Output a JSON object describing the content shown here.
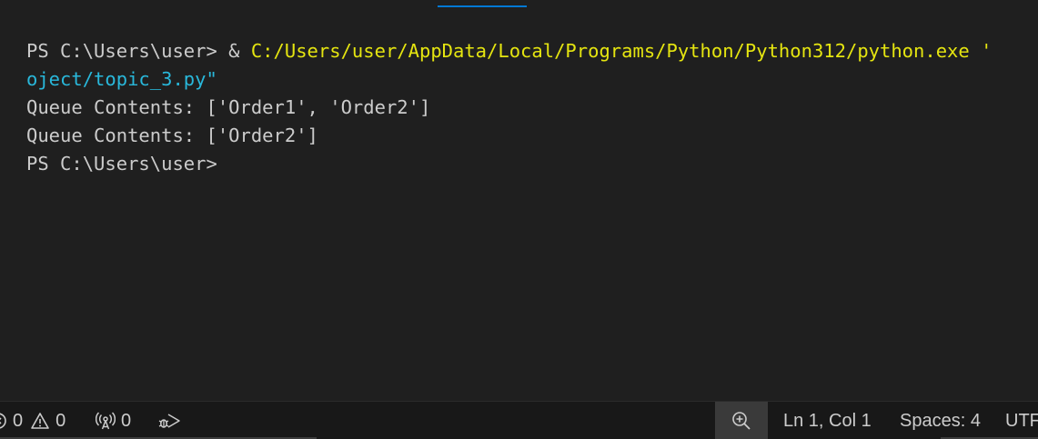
{
  "terminal": {
    "line1_prompt": "PS C:\\Users\\user> & ",
    "line1_path": "C:/Users/user/AppData/Local/Programs/Python/Python312/python.exe '",
    "line2": "oject/topic_3.py\"",
    "line3": "Queue Contents: ['Order1', 'Order2']",
    "line4": "Queue Contents: ['Order2']",
    "line5": "PS C:\\Users\\user>"
  },
  "statusbar": {
    "errors_count": "0",
    "warnings_count": "0",
    "ports_count": "0",
    "cursor_position": "Ln 1, Col 1",
    "indentation": "Spaces: 4",
    "encoding": "UTF"
  },
  "colors": {
    "background": "#1f1f1f",
    "statusbar_bg": "#181818",
    "path_yellow": "#e5e510",
    "path_cyan": "#29b8db",
    "accent": "#0078d4"
  },
  "icons": [
    "error-icon",
    "warning-icon",
    "broadcast-icon",
    "run-debug-icon",
    "zoom-in-icon"
  ]
}
